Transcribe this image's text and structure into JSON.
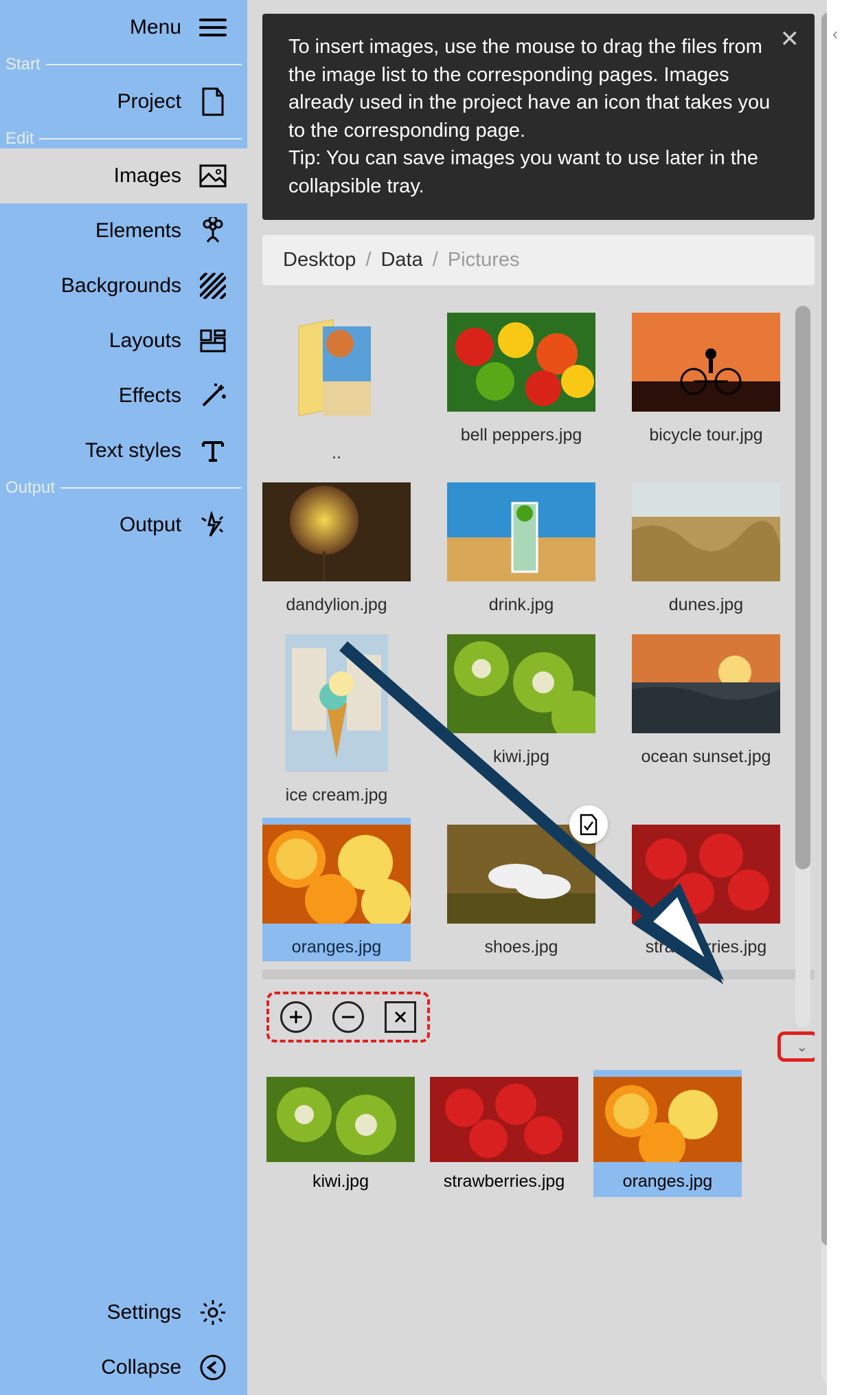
{
  "menu": {
    "label": "Menu"
  },
  "sections": {
    "start": "Start",
    "edit": "Edit",
    "output": "Output"
  },
  "sidebar": {
    "project": "Project",
    "images": "Images",
    "elements": "Elements",
    "backgrounds": "Backgrounds",
    "layouts": "Layouts",
    "effects": "Effects",
    "text_styles": "Text styles",
    "output_item": "Output",
    "settings": "Settings",
    "collapse": "Collapse"
  },
  "tip": {
    "text": "To insert images, use the mouse to drag the files from the image list to the corresponding pages. Images already used in the project have an icon that takes you to the corresponding page.\nTip: You can save images you want to use later in the collapsible tray."
  },
  "breadcrumb": {
    "a": "Desktop",
    "b": "Data",
    "c": "Pictures"
  },
  "files": {
    "up": "..",
    "bell_peppers": "bell peppers.jpg",
    "bicycle": "bicycle tour.jpg",
    "dandylion": "dandylion.jpg",
    "drink": "drink.jpg",
    "dunes": "dunes.jpg",
    "icecream": "ice cream.jpg",
    "kiwi": "kiwi.jpg",
    "ocean": "ocean sunset.jpg",
    "oranges": "oranges.jpg",
    "shoes": "shoes.jpg",
    "strawberries": "strawberries.jpg"
  },
  "tray": {
    "kiwi": "kiwi.jpg",
    "strawberries": "strawberries.jpg",
    "oranges": "oranges.jpg"
  }
}
